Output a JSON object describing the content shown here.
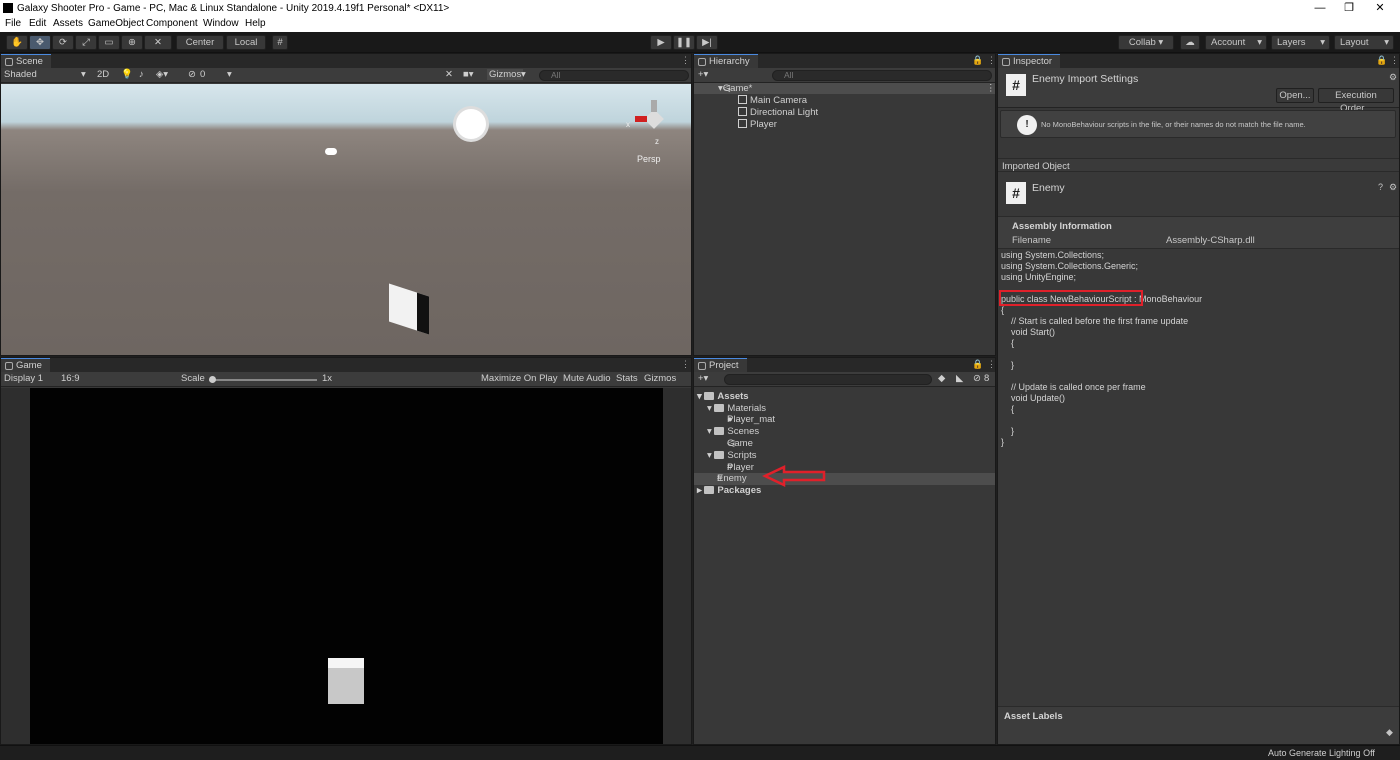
{
  "window": {
    "title": "Galaxy Shooter Pro - Game - PC, Mac & Linux Standalone - Unity 2019.4.19f1 Personal* <DX11>",
    "minimize": "—",
    "maximize": "❐",
    "close": "✕"
  },
  "menu": [
    "File",
    "Edit",
    "Assets",
    "GameObject",
    "Component",
    "Window",
    "Help"
  ],
  "toolbar": {
    "pivot": "Center",
    "space": "Local",
    "collab": "Collab ▾",
    "account": "Account",
    "layers": "Layers",
    "layout": "Layout"
  },
  "scene": {
    "tab": "Scene",
    "shading": "Shaded",
    "mode_2d": "2D",
    "hidden_count": "0",
    "gizmos": "Gizmos",
    "search_placeholder": "All",
    "persp": "Persp",
    "axis_x": "x",
    "axis_z": "z"
  },
  "game": {
    "tab": "Game",
    "display": "Display 1",
    "aspect": "16:9",
    "scale_label": "Scale",
    "scale_value": "1x",
    "maximize_on_play": "Maximize On Play",
    "mute_audio": "Mute Audio",
    "stats": "Stats",
    "gizmos": "Gizmos"
  },
  "hierarchy": {
    "tab": "Hierarchy",
    "search_placeholder": "All",
    "scene_name": "Game*",
    "items": [
      "Main Camera",
      "Directional Light",
      "Player"
    ]
  },
  "project": {
    "tab": "Project",
    "hidden_count": "8",
    "tree": {
      "assets": "Assets",
      "materials": "Materials",
      "player_mat": "Player_mat",
      "scenes": "Scenes",
      "game": "Game",
      "scripts": "Scripts",
      "player": "Player",
      "enemy": "Enemy",
      "packages": "Packages"
    }
  },
  "inspector": {
    "tab": "Inspector",
    "import_title": "Enemy Import Settings",
    "open_button": "Open...",
    "execution_order_button": "Execution Order...",
    "warning": "No MonoBehaviour scripts in the file, or their names do not match the file name.",
    "imported_object": "Imported Object",
    "object_name": "Enemy",
    "assembly_info": "Assembly Information",
    "filename_label": "Filename",
    "filename_value": "Assembly-CSharp.dll",
    "code": [
      "using System.Collections;",
      "using System.Collections.Generic;",
      "using UnityEngine;",
      "",
      "public class NewBehaviourScript : MonoBehaviour",
      "{",
      "    // Start is called before the first frame update",
      "    void Start()",
      "    {",
      "",
      "    }",
      "",
      "    // Update is called once per frame",
      "    void Update()",
      "    {",
      "",
      "    }",
      "}"
    ],
    "asset_labels": "Asset Labels"
  },
  "status": {
    "lighting": "Auto Generate Lighting Off"
  },
  "colors": {
    "highlight": "#e0202a",
    "selection": "#4d4d4d",
    "panel": "#383838",
    "scene_ground": "#6e6661",
    "scene_sky": "#c9dde5"
  }
}
